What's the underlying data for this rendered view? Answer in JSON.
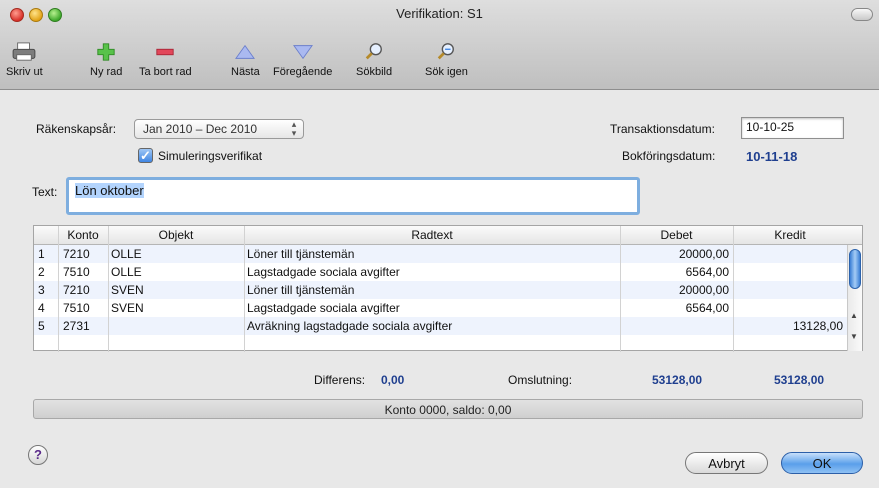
{
  "window": {
    "title": "Verifikation: S1"
  },
  "toolbar": {
    "print": "Skriv ut",
    "new_row": "Ny rad",
    "delete_row": "Ta bort rad",
    "next": "Nästa",
    "previous": "Föregående",
    "search_view": "Sökbild",
    "search_again": "Sök igen"
  },
  "form": {
    "fiscal_year_label": "Räkenskapsår:",
    "fiscal_year_value": "Jan 2010 – Dec 2010",
    "simulation_label": "Simuleringsverifikat",
    "simulation_checked": true,
    "transaction_date_label": "Transaktionsdatum:",
    "transaction_date_value": "10-10-25",
    "booking_date_label": "Bokföringsdatum:",
    "booking_date_value": "10-11-18",
    "text_label": "Text:",
    "text_value": "Lön oktober"
  },
  "table": {
    "columns": [
      "Konto",
      "Objekt",
      "Radtext",
      "Debet",
      "Kredit"
    ],
    "rows": [
      {
        "num": "1",
        "konto": "7210",
        "objekt": "OLLE",
        "radtext": "Löner till tjänstemän",
        "debet": "20000,00",
        "kredit": ""
      },
      {
        "num": "2",
        "konto": "7510",
        "objekt": "OLLE",
        "radtext": "Lagstadgade sociala avgifter",
        "debet": "6564,00",
        "kredit": ""
      },
      {
        "num": "3",
        "konto": "7210",
        "objekt": "SVEN",
        "radtext": "Löner till tjänstemän",
        "debet": "20000,00",
        "kredit": ""
      },
      {
        "num": "4",
        "konto": "7510",
        "objekt": "SVEN",
        "radtext": "Lagstadgade sociala avgifter",
        "debet": "6564,00",
        "kredit": ""
      },
      {
        "num": "5",
        "konto": "2731",
        "objekt": "",
        "radtext": "Avräkning lagstadgade sociala avgifter",
        "debet": "",
        "kredit": "13128,00"
      }
    ]
  },
  "totals": {
    "differens_label": "Differens:",
    "differens_value": "0,00",
    "omslutning_label": "Omslutning:",
    "debet_total": "53128,00",
    "kredit_total": "53128,00"
  },
  "status": {
    "text": "Konto 0000, saldo: 0,00"
  },
  "buttons": {
    "cancel": "Avbryt",
    "ok": "OK",
    "help": "?"
  },
  "colors": {
    "accent_blue": "#1f3f8f",
    "selection": "#b3d4fd",
    "row_stripe": "#eef3fd"
  }
}
